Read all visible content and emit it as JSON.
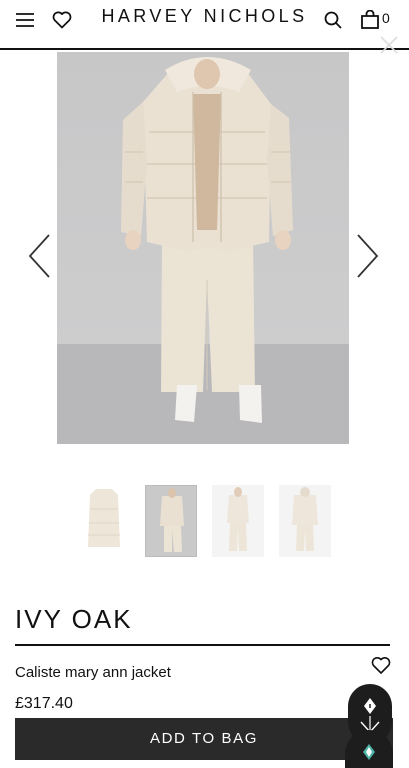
{
  "header": {
    "brand": "HARVEY NICHOLS",
    "bag_count": "0"
  },
  "product": {
    "brand": "IVY OAK",
    "name": "Caliste mary ann jacket",
    "price": "£317.40",
    "add_to_bag_label": "ADD TO BAG"
  },
  "colors": {
    "button": "#2a2a2a",
    "hero_background": "#c9c9ca",
    "jacket": "#ece3d6"
  }
}
